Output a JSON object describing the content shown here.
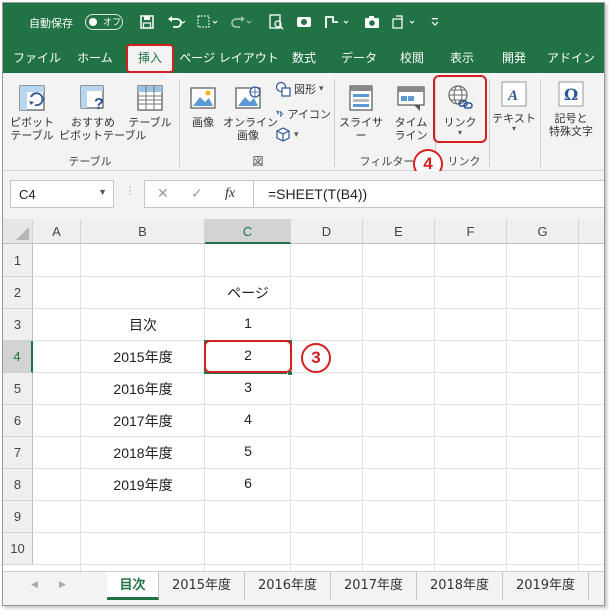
{
  "titlebar": {
    "autosave_label": "自動保存",
    "autosave_state": "オフ"
  },
  "ribbon_tabs": [
    "ファイル",
    "ホーム",
    "挿入",
    "ページ レイアウト",
    "数式",
    "データ",
    "校閲",
    "表示",
    "開発",
    "アドイン"
  ],
  "active_tab": "挿入",
  "ribbon": {
    "pivot_table": "ピボット\nテーブル",
    "recommended_pivot": "おすすめ\nピボットテーブル",
    "table": "テーブル",
    "tables_group": "テーブル",
    "picture": "画像",
    "online_picture": "オンライン\n画像",
    "shapes": "図形",
    "icons": "アイコン",
    "illustrations_group": "図",
    "slicer": "スライサー",
    "timeline": "タイム\nライン",
    "filters_group": "フィルター",
    "link": "リンク",
    "links_group": "リンク",
    "text": "テキスト",
    "symbols": "記号と\n特殊文字"
  },
  "formula_bar": {
    "name_box": "C4",
    "cancel": "✕",
    "enter": "✓",
    "fx": "fx",
    "formula": "=SHEET(T(B4))"
  },
  "columns": [
    "A",
    "B",
    "C",
    "D",
    "E",
    "F",
    "G"
  ],
  "rows": [
    "1",
    "2",
    "3",
    "4",
    "5",
    "6",
    "7",
    "8",
    "9",
    "10"
  ],
  "cells": {
    "C2": "ページ",
    "B3": "目次",
    "C3": "1",
    "B4": "2015年度",
    "C4": "2",
    "B5": "2016年度",
    "C5": "3",
    "B6": "2017年度",
    "C6": "4",
    "B7": "2018年度",
    "C7": "5",
    "B8": "2019年度",
    "C8": "6"
  },
  "selected_cell": "C4",
  "annotations": {
    "step3": "3",
    "step4": "4"
  },
  "sheet_tabs": [
    "目次",
    "2015年度",
    "2016年度",
    "2017年度",
    "2018年度",
    "2019年度"
  ],
  "active_sheet": "目次",
  "colors": {
    "accent": "#217346",
    "highlight": "#d42020"
  }
}
